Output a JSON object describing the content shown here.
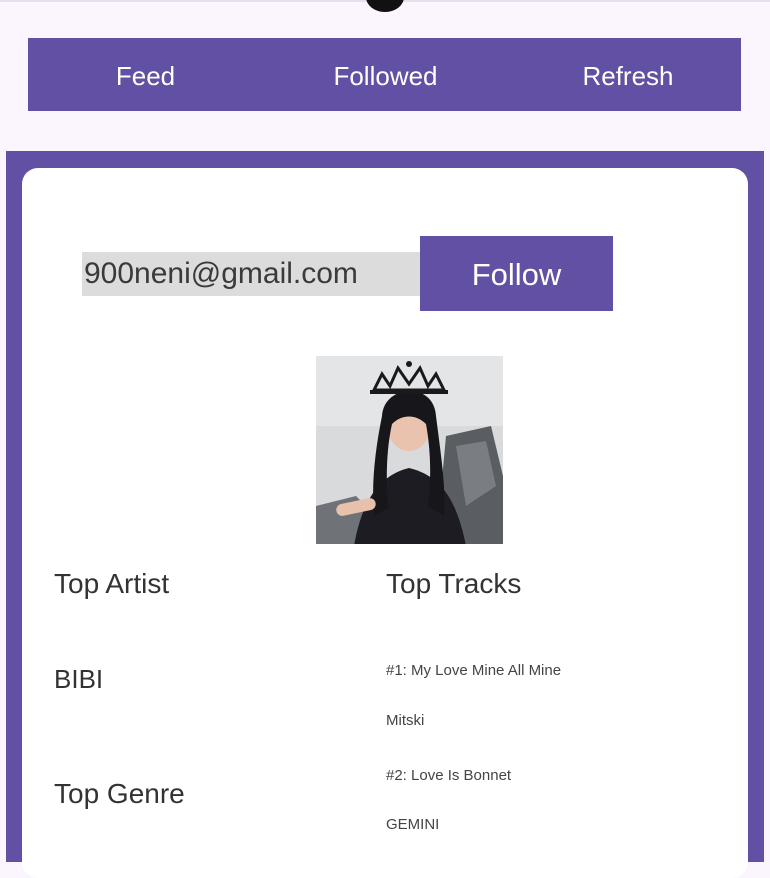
{
  "nav": {
    "feed_label": "Feed",
    "followed_label": "Followed",
    "refresh_label": "Refresh"
  },
  "profile": {
    "email_value": "900neni@gmail.com",
    "follow_label": "Follow",
    "top_artist_label": "Top Artist",
    "top_artist_value": "BIBI",
    "top_genre_label": "Top Genre",
    "top_tracks_label": "Top Tracks",
    "tracks": [
      {
        "title": "#1: My Love Mine All Mine",
        "artist": "Mitski"
      },
      {
        "title": "#2: Love Is Bonnet",
        "artist": "GEMINI"
      }
    ]
  },
  "colors": {
    "accent": "#6150a3",
    "background": "#fbf6fd",
    "card": "#ffffff",
    "field": "#dcdcdc"
  }
}
